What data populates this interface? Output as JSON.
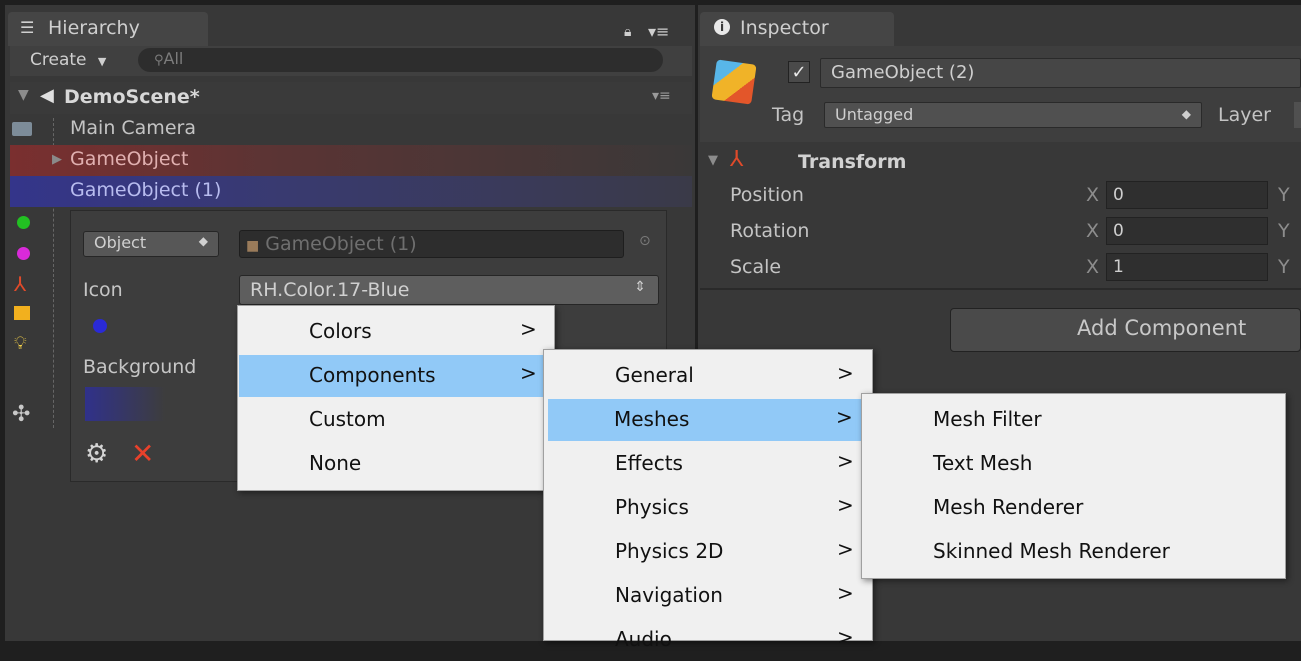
{
  "hierarchy": {
    "tab_label": "Hierarchy",
    "create_label": "Create",
    "search_placeholder": "All",
    "scene_name": "DemoScene*",
    "rows": [
      {
        "label": "Main Camera"
      },
      {
        "label": "GameObject"
      },
      {
        "label": "GameObject (1)"
      }
    ],
    "popup": {
      "object_dropdown": "Object",
      "object_field": "GameObject (1)",
      "icon_label": "Icon",
      "icon_value": "RH.Color.17-Blue",
      "background_label": "Background"
    }
  },
  "inspector": {
    "tab_label": "Inspector",
    "object_name": "GameObject (2)",
    "tag_label": "Tag",
    "tag_value": "Untagged",
    "layer_label": "Layer",
    "component_title": "Transform",
    "position_label": "Position",
    "rotation_label": "Rotation",
    "scale_label": "Scale",
    "axis_x": "X",
    "axis_y": "Y",
    "position_x": "0",
    "rotation_x": "0",
    "scale_x": "1",
    "add_component_label": "Add Component"
  },
  "menus": {
    "level1": [
      "Colors",
      "Components",
      "Custom",
      "None"
    ],
    "level2": [
      "General",
      "Meshes",
      "Effects",
      "Physics",
      "Physics 2D",
      "Navigation",
      "Audio"
    ],
    "level3": [
      "Mesh Filter",
      "Text Mesh",
      "Mesh Renderer",
      "Skinned Mesh Renderer"
    ],
    "submenu_arrow": ">"
  },
  "colors": {
    "row_red": "#7a2f2f",
    "row_blue": "#34358a",
    "menu_highlight": "#91c9f7",
    "delete_red": "#e8412b"
  }
}
